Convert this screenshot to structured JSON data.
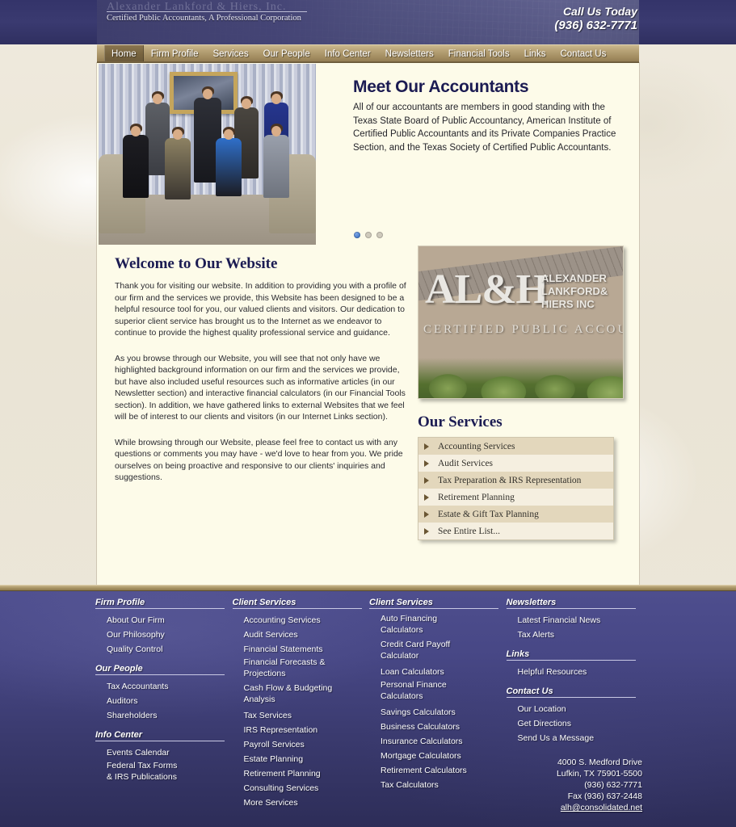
{
  "header": {
    "logo_name": "Alexander Lankford & Hiers, Inc.",
    "logo_tagline": "Certified Public Accountants, A Professional Corporation",
    "call_title": "Call Us Today",
    "call_phone": "(936) 632-7771"
  },
  "nav": {
    "items": [
      {
        "label": "Home",
        "active": true
      },
      {
        "label": "Firm Profile",
        "active": false
      },
      {
        "label": "Services",
        "active": false
      },
      {
        "label": "Our People",
        "active": false
      },
      {
        "label": "Info Center",
        "active": false
      },
      {
        "label": "Newsletters",
        "active": false
      },
      {
        "label": "Financial Tools",
        "active": false
      },
      {
        "label": "Links",
        "active": false
      },
      {
        "label": "Contact Us",
        "active": false
      }
    ]
  },
  "hero": {
    "photo_alt": "group-photo-of-accountants",
    "title": "Meet Our Accountants",
    "body": "All of our accountants are members in good standing with the Texas State Board of Public Accountancy, American Institute of Certified Public Accountants and its Private Companies Practice Section, and the Texas Society of Certified Public Accountants.",
    "slide_count": 3,
    "active_slide": 1
  },
  "welcome": {
    "title": "Welcome to Our Website",
    "paragraphs": [
      "Thank you for visiting our website. In addition to providing you with a profile of our firm and the services we provide, this Website has been designed to be a helpful resource tool for you, our valued clients and visitors. Our dedication to superior client service has brought us to the Internet as we endeavor to continue to provide the highest quality professional service and guidance.",
      "As you browse through our Website, you will see that not only have we highlighted background information on our firm and the services we provide, but have also included useful resources such as informative articles (in our Newsletter section) and interactive financial calculators (in our Financial Tools section). In addition, we have gathered links to external Websites that we feel will be of interest to our clients and visitors (in our Internet Links section).",
      "While browsing through our Website, please feel free to contact us with any questions or comments you may have - we'd love to hear from you. We pride ourselves on being proactive and responsive to our clients' inquiries and suggestions."
    ]
  },
  "sign_photo": {
    "monogram": "AL&H",
    "firm_lines": "ALEXANDER\nLANKFORD&\nHIERS INC",
    "subtitle": "CERTIFIED  PUBLIC  ACCOUNTANTS"
  },
  "services": {
    "title": "Our Services",
    "items": [
      "Accounting Services",
      "Audit Services",
      "Tax Preparation & IRS Representation",
      "Retirement Planning",
      "Estate & Gift Tax Planning",
      "See Entire List..."
    ]
  },
  "footer": {
    "columns": [
      {
        "groups": [
          {
            "heading": "Firm Profile",
            "links": [
              "About Our Firm",
              "Our Philosophy",
              "Quality Control"
            ]
          },
          {
            "heading": "Our People",
            "links": [
              "Tax Accountants",
              "Auditors",
              "Shareholders"
            ]
          },
          {
            "heading": "Info Center",
            "links": [
              "Events Calendar",
              "Federal Tax Forms\n  & IRS Publications"
            ]
          }
        ]
      },
      {
        "groups": [
          {
            "heading": "Client Services",
            "links": [
              "Accounting Services",
              "Audit Services",
              "Financial Statements",
              "Financial Forecasts &\n  Projections",
              "Cash Flow & Budgeting\n  Analysis",
              "Tax Services",
              "IRS Representation",
              "Payroll Services",
              "Estate Planning",
              "Retirement Planning",
              "Consulting Services",
              "More Services"
            ]
          }
        ]
      },
      {
        "groups": [
          {
            "heading": "Client Services",
            "links": [
              "Auto Financing\n  Calculators",
              "Credit Card Payoff\n  Calculator",
              "Loan Calculators",
              "Personal Finance\n  Calculators",
              "Savings Calculators",
              "Business Calculators",
              "Insurance Calculators",
              "Mortgage Calculators",
              "Retirement Calculators",
              "Tax Calculators"
            ]
          }
        ]
      },
      {
        "groups": [
          {
            "heading": "Newsletters",
            "links": [
              "Latest Financial News",
              "Tax Alerts"
            ]
          },
          {
            "heading": "Links",
            "links": [
              "Helpful Resources"
            ]
          },
          {
            "heading": "Contact Us",
            "links": [
              "Our Location",
              "Get Directions",
              "Send Us a Message"
            ]
          }
        ]
      }
    ],
    "address": {
      "street": "4000 S. Medford Drive",
      "city_state_zip": "Lufkin, TX 75901-5500",
      "phone": "(936) 632-7771",
      "fax": "Fax (936) 637-2448",
      "email": "alh@consolidated.net"
    }
  },
  "colors": {
    "header_blue": "#3a3a70",
    "nav_tan": "#b9a478",
    "page_cream": "#fdfbe9",
    "heading_navy": "#1b1b52",
    "footer_purple": "#474785",
    "service_row_alt": "#e3d7bc"
  }
}
